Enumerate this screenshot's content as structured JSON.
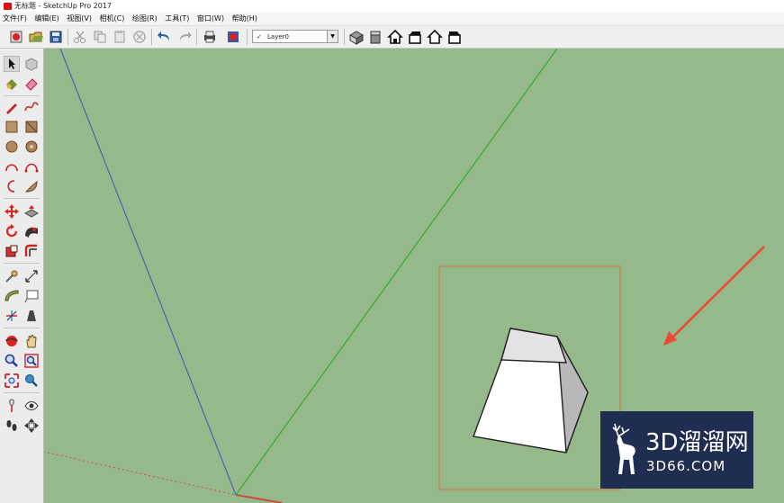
{
  "window": {
    "title": "无标题 - SketchUp Pro 2017"
  },
  "menu": [
    {
      "label": "文件(F)"
    },
    {
      "label": "编辑(E)"
    },
    {
      "label": "视图(V)"
    },
    {
      "label": "相机(C)"
    },
    {
      "label": "绘图(R)"
    },
    {
      "label": "工具(T)"
    },
    {
      "label": "窗口(W)"
    },
    {
      "label": "帮助(H)"
    }
  ],
  "layer": {
    "current": "Layer0"
  },
  "watermark": {
    "brand": "3D溜溜网",
    "domain": "3D66.COM"
  },
  "colors": {
    "canvas": "#95b98b",
    "red_axis": "#c8503c",
    "green_axis": "#2fae2f",
    "blue_axis": "#4a62b0",
    "selection_box": "#c87a4e",
    "arrow": "#e84a35",
    "watermark_bg": "#1e2d50"
  }
}
